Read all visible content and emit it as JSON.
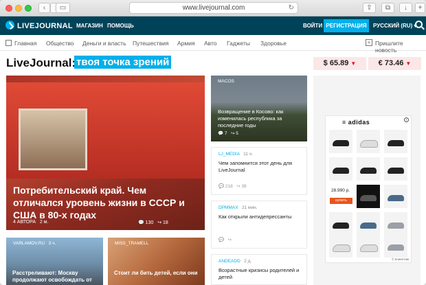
{
  "browser": {
    "url": "www.livejournal.com"
  },
  "header": {
    "logo": "LIVEJOURNAL",
    "links": [
      "МАГАЗИН",
      "ПОМОЩЬ"
    ],
    "login": "ВОЙТИ",
    "register": "РЕГИСТРАЦИЯ",
    "language": "РУССКИЙ (RU)"
  },
  "nav": {
    "items": [
      "Главная",
      "Общество",
      "Деньги и власть",
      "Путешествия",
      "Армия",
      "Авто",
      "Гаджеты",
      "Здоровье"
    ],
    "suggest": "Пришлите новость"
  },
  "title": {
    "part1": "LiveJournal:",
    "part2": "твоя точка зрений"
  },
  "rates": [
    {
      "value": "$ 65.89"
    },
    {
      "value": "€ 73.46"
    }
  ],
  "feature": {
    "title": "Потребительский край. Чем отличался уровень жизни в СССР и США в 80-х годах",
    "authors": "4 АВТОРА",
    "time": "2 м.",
    "comments": "130",
    "reposts": "18"
  },
  "side": [
    {
      "user": "MACOS",
      "time": "",
      "title": "Возвращение в Косово: как изменилась республика за последние годы",
      "comments": "7",
      "reposts": "5"
    },
    {
      "user": "LJ_MEDIA",
      "time": "11 ч.",
      "title": "Чем запомнится этот день для LiveJournal",
      "comments": "218",
      "reposts": "39"
    },
    {
      "user": "DPMMAX",
      "time": "21 мин.",
      "title": "Как открыли антидепрессанты",
      "comments": "",
      "reposts": ""
    },
    {
      "user": "ANDEADD",
      "time": "2 д.",
      "title": "Возрастные кризисы родителей и детей",
      "comments": "",
      "reposts": ""
    }
  ],
  "bottom": [
    {
      "user": "VARLAMOV.RU",
      "time": "3 ч.",
      "title": "Расстреливают: Москву продолжают освобождать от"
    },
    {
      "user": "MISS_TRAMELL",
      "time": "",
      "title": "Стоит ли бить детей, если они"
    }
  ],
  "ad": {
    "brand": "adidas",
    "price": "28.990 р.",
    "buy": "купить",
    "credit": "© Клиентам"
  },
  "colors": {
    "header_bg": "#004359",
    "accent": "#00b0ea",
    "rate_bg": "#fbe7e7"
  }
}
